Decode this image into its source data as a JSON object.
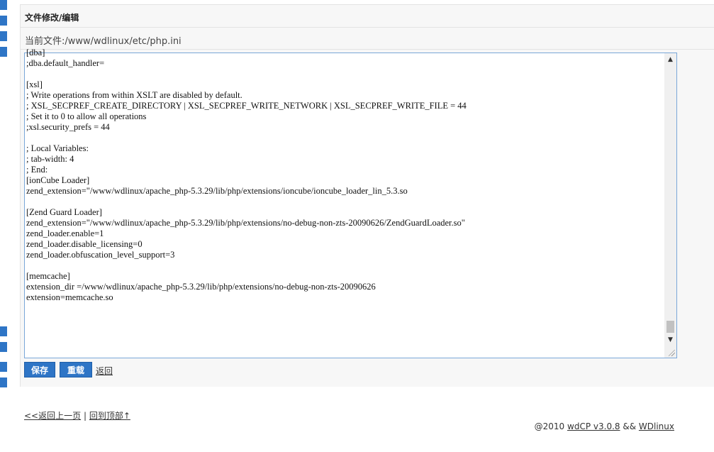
{
  "panel": {
    "title": "文件修改/编辑",
    "current_file_label": "当前文件:",
    "current_file_path": "/www/wdlinux/etc/php.ini"
  },
  "editor": {
    "lines": [
      "[dba]",
      ";dba.default_handler=",
      "",
      "[xsl]",
      "; Write operations from within XSLT are disabled by default.",
      "; XSL_SECPREF_CREATE_DIRECTORY | XSL_SECPREF_WRITE_NETWORK | XSL_SECPREF_WRITE_FILE = 44",
      "; Set it to 0 to allow all operations",
      ";xsl.security_prefs = 44",
      "",
      "; Local Variables:",
      "; tab-width: 4",
      "; End:",
      "[ionCube Loader]",
      "zend_extension=\"/www/wdlinux/apache_php-5.3.29/lib/php/extensions/ioncube/ioncube_loader_lin_5.3.so",
      "",
      "[Zend Guard Loader]",
      "zend_extension=\"/www/wdlinux/apache_php-5.3.29/lib/php/extensions/no-debug-non-zts-20090626/ZendGuardLoader.so\"",
      "zend_loader.enable=1",
      "zend_loader.disable_licensing=0",
      "zend_loader.obfuscation_level_support=3",
      "",
      "[memcache]",
      "extension_dir =/www/wdlinux/apache_php-5.3.29/lib/php/extensions/no-debug-non-zts-20090626",
      "extension=memcache.so"
    ],
    "scroll_position": 0.93
  },
  "actions": {
    "save_label": "保存",
    "reset_label": "重载",
    "back_label": "返回"
  },
  "bottom_nav": {
    "prev_label": "<<返回上一页",
    "separator": "|",
    "top_label": "回到顶部↑"
  },
  "footer": {
    "copyright": "@2010",
    "product": "wdCP v3.0.8",
    "amp": "&&",
    "brand": "WDlinux"
  },
  "colors": {
    "accent": "#2e75c6",
    "editor_border": "#7aa7d8",
    "panel_bg": "#f7f7f7"
  }
}
